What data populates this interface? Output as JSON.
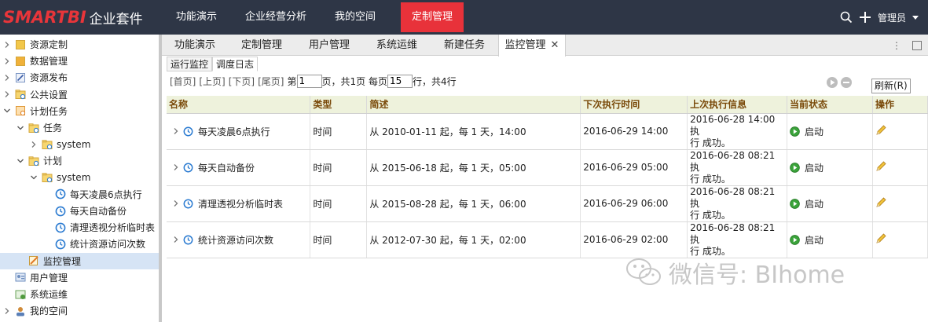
{
  "app": {
    "logo_main": "SMARTBI",
    "logo_sub": "企业套件"
  },
  "topnav": {
    "items": [
      "功能演示",
      "企业经营分析",
      "我的空间",
      "定制管理"
    ],
    "active_index": 3,
    "user": "管理员"
  },
  "sidebar": {
    "items": [
      {
        "label": "资源定制",
        "level": 0,
        "expanded": false,
        "icon": "folder-icon"
      },
      {
        "label": "数据管理",
        "level": 0,
        "expanded": false,
        "icon": "data-icon"
      },
      {
        "label": "资源发布",
        "level": 0,
        "expanded": false,
        "icon": "publish-icon"
      },
      {
        "label": "公共设置",
        "level": 0,
        "expanded": false,
        "icon": "settings-icon"
      },
      {
        "label": "计划任务",
        "level": 0,
        "expanded": true,
        "icon": "task-icon"
      },
      {
        "label": "任务",
        "level": 1,
        "expanded": true,
        "icon": "task-folder-icon"
      },
      {
        "label": "system",
        "level": 2,
        "expanded": false,
        "icon": "system-folder-icon"
      },
      {
        "label": "计划",
        "level": 1,
        "expanded": true,
        "icon": "plan-folder-icon"
      },
      {
        "label": "system",
        "level": 2,
        "expanded": true,
        "icon": "system-folder-icon"
      },
      {
        "label": "每天凌晨6点执行",
        "level": 3,
        "icon": "clock-icon"
      },
      {
        "label": "每天自动备份",
        "level": 3,
        "icon": "clock-icon"
      },
      {
        "label": "清理透视分析临时表",
        "level": 3,
        "icon": "clock-icon"
      },
      {
        "label": "统计资源访问次数",
        "level": 3,
        "icon": "clock-icon"
      },
      {
        "label": "监控管理",
        "level": 1,
        "selected": true,
        "icon": "monitor-icon"
      },
      {
        "label": "用户管理",
        "level": 0,
        "icon": "user-manage-icon"
      },
      {
        "label": "系统运维",
        "level": 0,
        "icon": "ops-icon"
      },
      {
        "label": "我的空间",
        "level": 0,
        "expanded": false,
        "icon": "myspace-icon"
      }
    ]
  },
  "tabs": {
    "items": [
      "功能演示",
      "定制管理",
      "用户管理",
      "系统运维",
      "新建任务",
      "监控管理"
    ],
    "active_index": 5
  },
  "subtabs": {
    "items": [
      "运行监控",
      "调度日志"
    ],
    "active_index": 1
  },
  "pager": {
    "first": "[首页]",
    "prev": "[上页]",
    "next": "[下页]",
    "last": "[尾页]",
    "page_prefix": "第",
    "page_value": "1",
    "page_suffix": "页，共1页 每页",
    "size_value": "15",
    "size_suffix": "行，共4行",
    "refresh": "刷新(R)"
  },
  "table": {
    "headers": [
      "名称",
      "类型",
      "简述",
      "下次执行时间",
      "上次执行信息",
      "当前状态",
      "操作"
    ],
    "rows": [
      {
        "name": "每天凌晨6点执行",
        "type": "时间",
        "desc": "从 2010-01-11 起，每 1 天，14:00",
        "next": "2016-06-29 14:00",
        "last1": "2016-06-28 14:00 执",
        "last2": "行 成功。",
        "status": "启动"
      },
      {
        "name": "每天自动备份",
        "type": "时间",
        "desc": "从 2015-06-18 起，每 1 天，05:00",
        "next": "2016-06-29 05:00",
        "last1": "2016-06-28 08:21 执",
        "last2": "行 成功。",
        "status": "启动"
      },
      {
        "name": "清理透视分析临时表",
        "type": "时间",
        "desc": "从 2015-08-28 起，每 1 天，06:00",
        "next": "2016-06-29 06:00",
        "last1": "2016-06-28 08:21 执",
        "last2": "行 成功。",
        "status": "启动"
      },
      {
        "name": "统计资源访问次数",
        "type": "时间",
        "desc": "从 2012-07-30 起，每 1 天，02:00",
        "next": "2016-06-29 02:00",
        "last1": "2016-06-28 08:21 执",
        "last2": "行 成功。",
        "status": "启动"
      }
    ]
  },
  "watermark": {
    "text": "微信号: BIhome"
  },
  "colors": {
    "topbar": "#2e3646",
    "accent": "#e8323a",
    "header_bg": "#eef2dc",
    "selected": "#d6e4f5"
  }
}
